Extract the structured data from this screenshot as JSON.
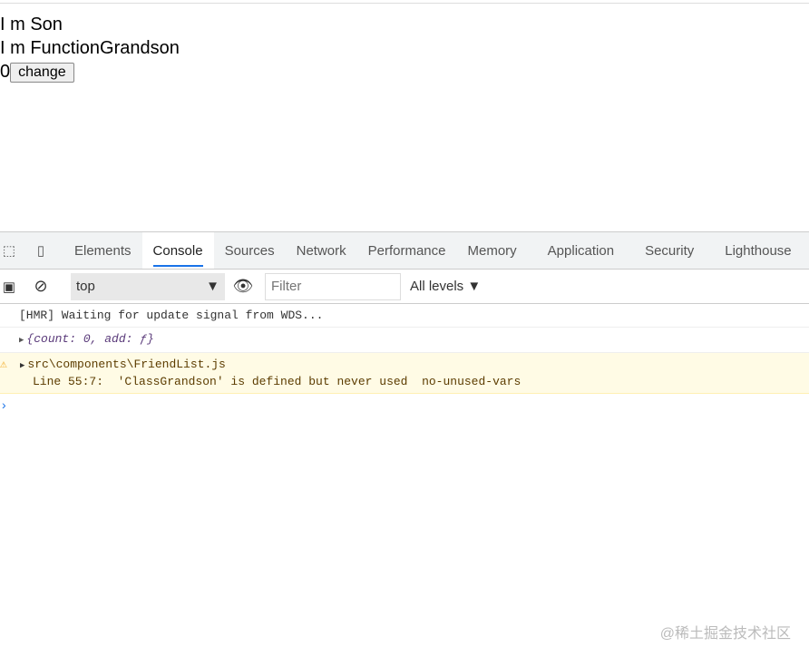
{
  "page": {
    "line1": "I m Son",
    "line2": "I m FunctionGrandson",
    "count": "0",
    "button": "change"
  },
  "devtools": {
    "tabs": [
      "Elements",
      "Console",
      "Sources",
      "Network",
      "Performance",
      "Memory",
      "Application",
      "Security",
      "Lighthouse"
    ],
    "context": "top",
    "filter_placeholder": "Filter",
    "levels": "All levels ▼",
    "messages": {
      "hmr": "[HMR] Waiting for update signal from WDS...",
      "obj": "{count: 0, add: ƒ}",
      "warn_file": "src\\components\\FriendList.js",
      "warn_text": "Line 55:7:  'ClassGrandson' is defined but never used  no-unused-vars"
    }
  },
  "watermark": "@稀土掘金技术社区"
}
